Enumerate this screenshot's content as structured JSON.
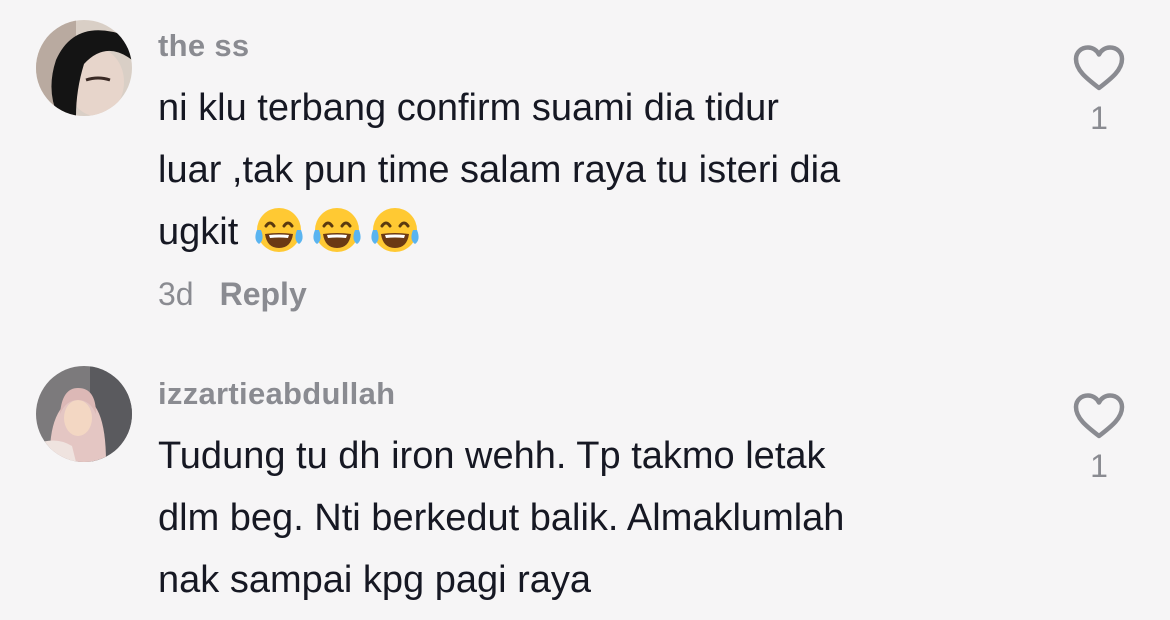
{
  "comments": [
    {
      "username": "the ss",
      "text_lines": [
        "ni klu terbang confirm suami dia tidur",
        "luar ,tak pun time salam raya tu isteri dia",
        "ugkit"
      ],
      "emojis": [
        "face-with-tears-of-joy",
        "face-with-tears-of-joy",
        "face-with-tears-of-joy"
      ],
      "age": "3d",
      "reply_label": "Reply",
      "like_count": "1",
      "avatar_icon": "avatar-photo"
    },
    {
      "username": "izzartieabdullah",
      "text_lines": [
        "Tudung tu dh iron wehh. Tp takmo letak",
        "dlm beg. Nti berkedut balik. Almaklumlah",
        "nak sampai kpg pagi raya"
      ],
      "like_count": "1",
      "avatar_icon": "avatar-photo"
    }
  ],
  "colors": {
    "background": "#f6f5f6",
    "text": "#161823",
    "secondary_text": "#8a8b91",
    "heart_outline": "#8a8b91"
  },
  "icons": {
    "like": "heart-outline-icon",
    "emoji": "face-with-tears-of-joy"
  }
}
